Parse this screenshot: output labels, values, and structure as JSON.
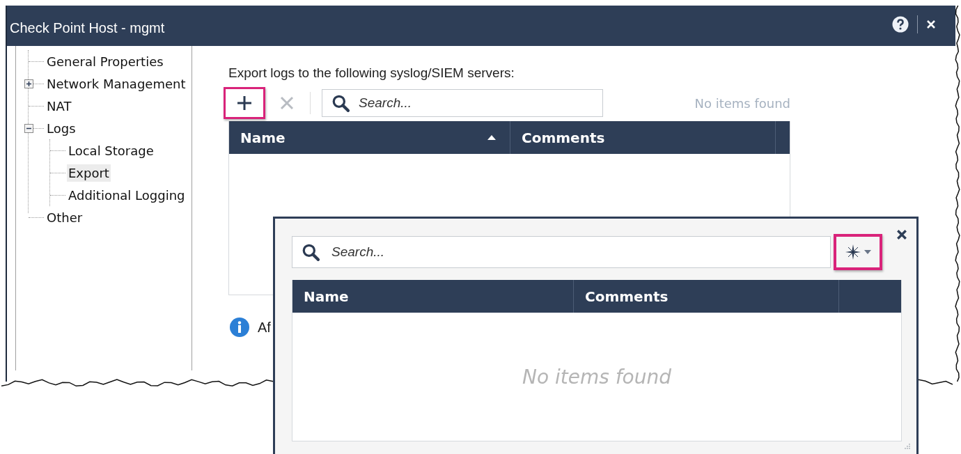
{
  "window": {
    "title": "Check Point Host - mgmt"
  },
  "tree": [
    {
      "label": "General Properties",
      "selected": false
    },
    {
      "label": "Network Management",
      "selected": false,
      "expanded": false
    },
    {
      "label": "NAT",
      "selected": false
    },
    {
      "label": "Logs",
      "selected": false,
      "expanded": true,
      "children": [
        {
          "label": "Local Storage",
          "selected": false
        },
        {
          "label": "Export",
          "selected": true
        },
        {
          "label": "Additional Logging",
          "selected": false
        }
      ]
    },
    {
      "label": "Other",
      "selected": false
    }
  ],
  "export": {
    "heading": "Export logs to the following syslog/SIEM servers:",
    "toolbar": {
      "add": {
        "highlighted": true,
        "disabled": false
      },
      "remove": {
        "highlighted": false,
        "disabled": true
      }
    },
    "search": {
      "placeholder": "Search..."
    },
    "status": "No items found",
    "columns": [
      {
        "label": "Name",
        "sorted": true
      },
      {
        "label": "Comments",
        "sorted": false
      }
    ],
    "note": "Af"
  },
  "popup": {
    "search": {
      "placeholder": "Search..."
    },
    "new_button": {
      "highlighted": true
    },
    "columns": [
      {
        "label": "Name"
      },
      {
        "label": "Comments"
      }
    ],
    "empty_message": "No items found"
  }
}
